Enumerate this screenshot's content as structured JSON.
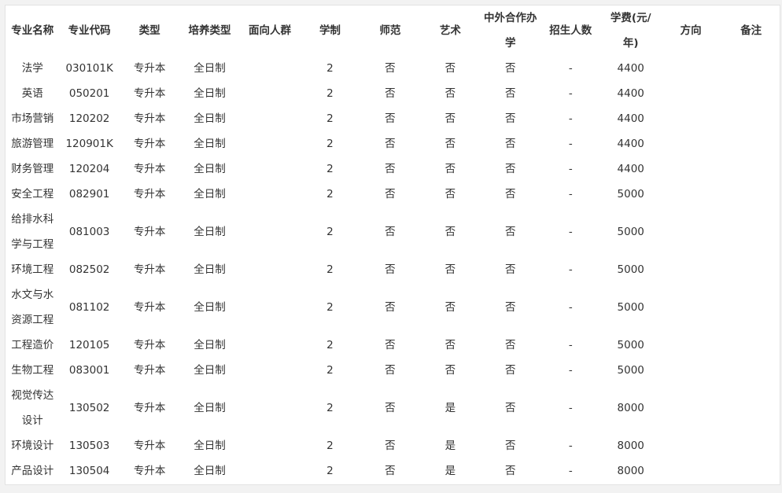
{
  "table": {
    "headers": [
      "专业名称",
      "专业代码",
      "类型",
      "培养类型",
      "面向人群",
      "学制",
      "师范",
      "艺术",
      "中外合作办学",
      "招生人数",
      "学费(元/年)",
      "方向",
      "备注"
    ],
    "rows": [
      {
        "name": "法学",
        "code": "030101K",
        "type": "专升本",
        "mode": "全日制",
        "audience": "",
        "years": "2",
        "normal": "否",
        "art": "否",
        "coop": "否",
        "enroll": "-",
        "fee": "4400",
        "direction": "",
        "remark": ""
      },
      {
        "name": "英语",
        "code": "050201",
        "type": "专升本",
        "mode": "全日制",
        "audience": "",
        "years": "2",
        "normal": "否",
        "art": "否",
        "coop": "否",
        "enroll": "-",
        "fee": "4400",
        "direction": "",
        "remark": ""
      },
      {
        "name": "市场营销",
        "code": "120202",
        "type": "专升本",
        "mode": "全日制",
        "audience": "",
        "years": "2",
        "normal": "否",
        "art": "否",
        "coop": "否",
        "enroll": "-",
        "fee": "4400",
        "direction": "",
        "remark": ""
      },
      {
        "name": "旅游管理",
        "code": "120901K",
        "type": "专升本",
        "mode": "全日制",
        "audience": "",
        "years": "2",
        "normal": "否",
        "art": "否",
        "coop": "否",
        "enroll": "-",
        "fee": "4400",
        "direction": "",
        "remark": ""
      },
      {
        "name": "财务管理",
        "code": "120204",
        "type": "专升本",
        "mode": "全日制",
        "audience": "",
        "years": "2",
        "normal": "否",
        "art": "否",
        "coop": "否",
        "enroll": "-",
        "fee": "4400",
        "direction": "",
        "remark": ""
      },
      {
        "name": "安全工程",
        "code": "082901",
        "type": "专升本",
        "mode": "全日制",
        "audience": "",
        "years": "2",
        "normal": "否",
        "art": "否",
        "coop": "否",
        "enroll": "-",
        "fee": "5000",
        "direction": "",
        "remark": ""
      },
      {
        "name": "给排水科学与工程",
        "code": "081003",
        "type": "专升本",
        "mode": "全日制",
        "audience": "",
        "years": "2",
        "normal": "否",
        "art": "否",
        "coop": "否",
        "enroll": "-",
        "fee": "5000",
        "direction": "",
        "remark": "",
        "tall": true
      },
      {
        "name": "环境工程",
        "code": "082502",
        "type": "专升本",
        "mode": "全日制",
        "audience": "",
        "years": "2",
        "normal": "否",
        "art": "否",
        "coop": "否",
        "enroll": "-",
        "fee": "5000",
        "direction": "",
        "remark": ""
      },
      {
        "name": "水文与水资源工程",
        "code": "081102",
        "type": "专升本",
        "mode": "全日制",
        "audience": "",
        "years": "2",
        "normal": "否",
        "art": "否",
        "coop": "否",
        "enroll": "-",
        "fee": "5000",
        "direction": "",
        "remark": "",
        "tall": true
      },
      {
        "name": "工程造价",
        "code": "120105",
        "type": "专升本",
        "mode": "全日制",
        "audience": "",
        "years": "2",
        "normal": "否",
        "art": "否",
        "coop": "否",
        "enroll": "-",
        "fee": "5000",
        "direction": "",
        "remark": ""
      },
      {
        "name": "生物工程",
        "code": "083001",
        "type": "专升本",
        "mode": "全日制",
        "audience": "",
        "years": "2",
        "normal": "否",
        "art": "否",
        "coop": "否",
        "enroll": "-",
        "fee": "5000",
        "direction": "",
        "remark": ""
      },
      {
        "name": "视觉传达设计",
        "code": "130502",
        "type": "专升本",
        "mode": "全日制",
        "audience": "",
        "years": "2",
        "normal": "否",
        "art": "是",
        "coop": "否",
        "enroll": "-",
        "fee": "8000",
        "direction": "",
        "remark": "",
        "tall": true
      },
      {
        "name": "环境设计",
        "code": "130503",
        "type": "专升本",
        "mode": "全日制",
        "audience": "",
        "years": "2",
        "normal": "否",
        "art": "是",
        "coop": "否",
        "enroll": "-",
        "fee": "8000",
        "direction": "",
        "remark": ""
      },
      {
        "name": "产品设计",
        "code": "130504",
        "type": "专升本",
        "mode": "全日制",
        "audience": "",
        "years": "2",
        "normal": "否",
        "art": "是",
        "coop": "否",
        "enroll": "-",
        "fee": "8000",
        "direction": "",
        "remark": ""
      }
    ]
  }
}
